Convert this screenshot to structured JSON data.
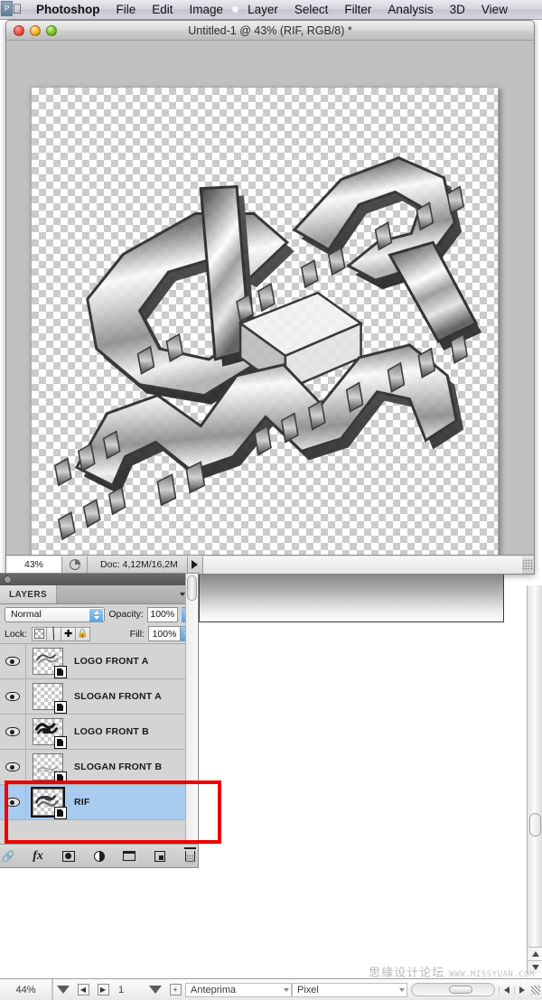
{
  "menubar": {
    "apple_icon": "apple-logo-icon",
    "app_name": "Photoshop",
    "items": [
      "File",
      "Edit",
      "Image",
      "Layer",
      "Select",
      "Filter",
      "Analysis",
      "3D",
      "View"
    ]
  },
  "document_window": {
    "title": "Untitled-1 @ 43% (RIF, RGB/8) *",
    "close_button": "close-icon",
    "minimize_button": "minimize-icon",
    "zoom_button": "zoom-icon",
    "status": {
      "zoom_value": "43%",
      "doc_info": "Doc: 4,12M/16,2M",
      "pie_icon": "pie-chart-icon",
      "arrow_icon": "triangle-right-icon"
    },
    "canvas": {
      "artwork_description": "3D isometric chrome logo artwork on transparent background"
    }
  },
  "layers_panel": {
    "tab_label": "LAYERS",
    "panel_menu_icon": "panel-menu-icon",
    "blend_mode": "Normal",
    "opacity_label": "Opacity:",
    "opacity_value": "100%",
    "lock_label": "Lock:",
    "lock_icons": [
      "lock-transparency-icon",
      "lock-pixels-icon",
      "lock-position-icon",
      "lock-all-icon"
    ],
    "fill_label": "Fill:",
    "fill_value": "100%",
    "layers": [
      {
        "name": "LOGO FRONT A",
        "visible": true,
        "selected": false,
        "has_art": true
      },
      {
        "name": "SLOGAN FRONT A",
        "visible": true,
        "selected": false,
        "has_art": false
      },
      {
        "name": "LOGO FRONT B",
        "visible": true,
        "selected": false,
        "has_art": true
      },
      {
        "name": "SLOGAN FRONT B",
        "visible": true,
        "selected": false,
        "has_art": true
      },
      {
        "name": "RIF",
        "visible": true,
        "selected": true,
        "has_art": true
      }
    ],
    "footer_icons": [
      "link-layers-icon",
      "layer-style-fx-icon",
      "layer-mask-icon",
      "adjustment-layer-icon",
      "new-group-icon",
      "new-layer-icon",
      "delete-layer-icon"
    ]
  },
  "annotation": {
    "color": "#ee0000",
    "target_layer": "RIF"
  },
  "bottom_bar": {
    "zoom_value": "44%",
    "page_number": "1",
    "preview_mode": "Anteprima",
    "units": "Pixel",
    "dropdown_icon": "triangle-down-icon",
    "prev_icon": "triangle-left-icon",
    "next_icon": "triangle-right-icon",
    "plus_icon": "plus-box-icon"
  },
  "watermark": {
    "chinese": "思緣设计论坛",
    "url": "WWW.MISSYUAN.COM"
  }
}
